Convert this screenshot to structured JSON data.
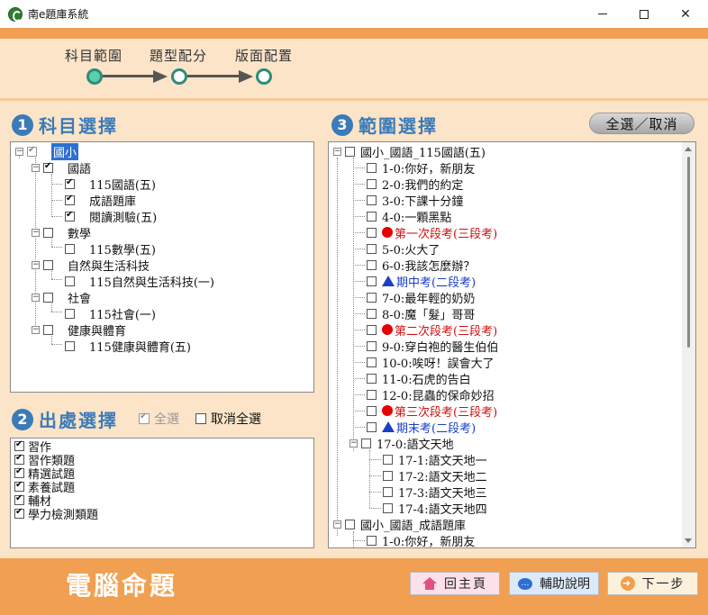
{
  "window": {
    "title": "南e題庫系統"
  },
  "stepper": {
    "steps": [
      "科目範圍",
      "題型配分",
      "版面配置"
    ]
  },
  "section1": {
    "num": "1",
    "title": "科目選擇"
  },
  "section2": {
    "num": "2",
    "title": "出處選擇",
    "select_all": "全選",
    "deselect_all": "取消全選"
  },
  "section3": {
    "num": "3",
    "title": "範圍選擇",
    "toggle_button": "全選／取消"
  },
  "subject_tree": {
    "root": "國小",
    "chinese": "國語",
    "chinese_items": [
      "115國語(五)",
      "成語題庫",
      "閱讀測驗(五)"
    ],
    "math": "數學",
    "math_items": [
      "115數學(五)"
    ],
    "science": "自然與生活科技",
    "science_items": [
      "115自然與生活科技(一)"
    ],
    "social": "社會",
    "social_items": [
      "115社會(一)"
    ],
    "health": "健康與體育",
    "health_items": [
      "115健康與體育(五)"
    ]
  },
  "source_list": [
    "習作",
    "習作類題",
    "精選試題",
    "素養試題",
    "輔材",
    "學力檢測類題"
  ],
  "range_tree": {
    "group1": "國小_國語_115國語(五)",
    "lessons": [
      {
        "text": "1-0:你好，新朋友",
        "type": "normal"
      },
      {
        "text": "2-0:我們的約定",
        "type": "normal"
      },
      {
        "text": "3-0:下課十分鐘",
        "type": "normal"
      },
      {
        "text": "4-0:一顆黑點",
        "type": "normal"
      },
      {
        "text": "第一次段考(三段考)",
        "type": "red"
      },
      {
        "text": "5-0:火大了",
        "type": "normal"
      },
      {
        "text": "6-0:我該怎麼辦？",
        "type": "normal"
      },
      {
        "text": "期中考(二段考)",
        "type": "blue"
      },
      {
        "text": "7-0:最年輕的奶奶",
        "type": "normal"
      },
      {
        "text": "8-0:魔「髮」哥哥",
        "type": "normal"
      },
      {
        "text": "第二次段考(三段考)",
        "type": "red"
      },
      {
        "text": "9-0:穿白袍的醫生伯伯",
        "type": "normal"
      },
      {
        "text": "10-0:唉呀！誤會大了",
        "type": "normal"
      },
      {
        "text": "11-0:石虎的告白",
        "type": "normal"
      },
      {
        "text": "12-0:昆蟲的保命妙招",
        "type": "normal"
      },
      {
        "text": "第三次段考(三段考)",
        "type": "red"
      },
      {
        "text": "期末考(二段考)",
        "type": "blue"
      }
    ],
    "unit17": "17-0:語文天地",
    "unit17_items": [
      "17-1:語文天地一",
      "17-2:語文天地二",
      "17-3:語文天地三",
      "17-4:語文天地四"
    ],
    "group2": "國小_國語_成語題庫",
    "group2_items": [
      "1-0:你好，新朋友"
    ]
  },
  "bottom": {
    "brand": "電腦命題",
    "home": "回主頁",
    "help": "輔助說明",
    "next": "下一步"
  },
  "colors": {
    "accent_orange": "#f0a050",
    "heading_blue": "#3b7bb8",
    "step_green": "#2e8b7a",
    "exam_red": "#d01010",
    "exam_blue": "#1a3fc7"
  }
}
